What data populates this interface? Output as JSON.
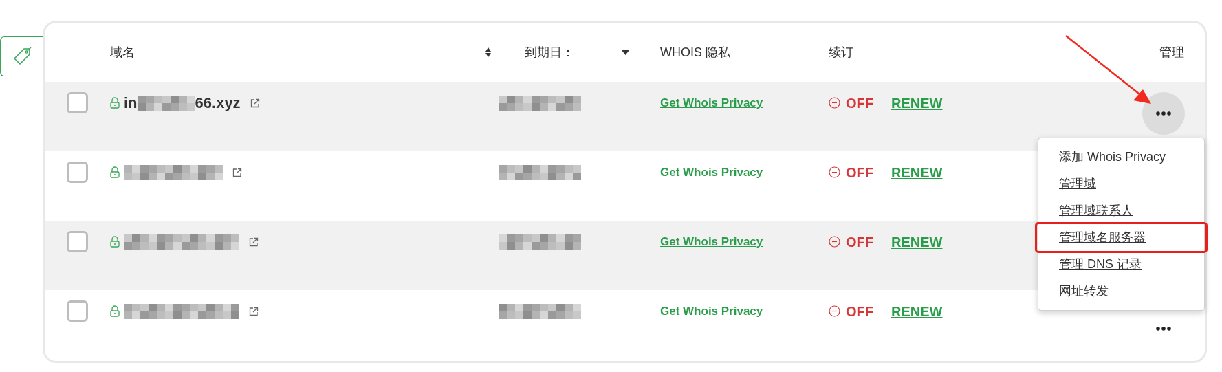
{
  "table": {
    "columns": [
      {
        "label": "域名",
        "kind": "sortable"
      },
      {
        "label": "到期日：",
        "kind": "dropdown"
      },
      {
        "label": "WHOIS 隐私"
      },
      {
        "label": "续订"
      },
      {
        "label": "管理"
      }
    ],
    "rows": [
      {
        "domain_start": "in",
        "domain_end": "66.xyz",
        "whois_link": "Get Whois Privacy",
        "renew_status": "OFF",
        "renew_link": "RENEW",
        "menu_open": true,
        "shaded": true,
        "checked": false
      },
      {
        "whois_link": "Get Whois Privacy",
        "renew_status": "OFF",
        "renew_link": "RENEW",
        "shaded": false,
        "checked": false
      },
      {
        "whois_link": "Get Whois Privacy",
        "renew_status": "OFF",
        "renew_link": "RENEW",
        "shaded": true,
        "checked": false
      },
      {
        "whois_link": "Get Whois Privacy",
        "renew_status": "OFF",
        "renew_link": "RENEW",
        "menu_open": false,
        "shaded": false,
        "checked": false
      }
    ]
  },
  "menu": {
    "items": [
      {
        "label": "添加 Whois Privacy",
        "highlighted": false
      },
      {
        "label": "管理域",
        "highlighted": false
      },
      {
        "label": "管理域联系人",
        "highlighted": false
      },
      {
        "label": "管理域名服务器",
        "highlighted": true
      },
      {
        "label": "管理 DNS 记录",
        "highlighted": false
      },
      {
        "label": "网址转发",
        "highlighted": false
      }
    ]
  }
}
